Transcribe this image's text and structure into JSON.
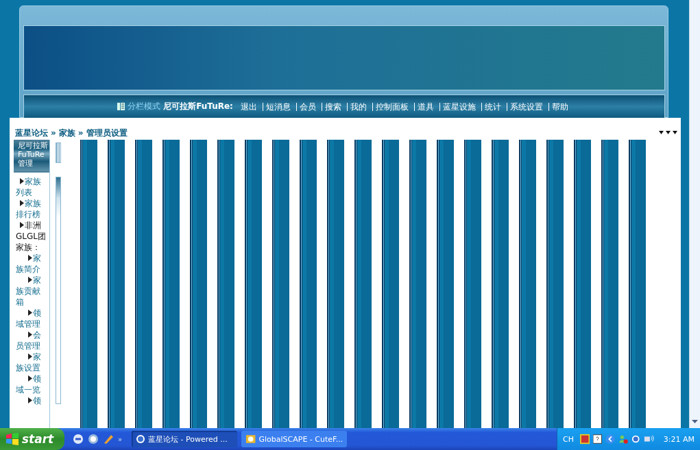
{
  "header": {
    "view_mode": "分栏模式",
    "user": "尼可拉斯FuTuRe:",
    "links": [
      "退出",
      "短消息",
      "会员",
      "搜索",
      "我的",
      "控制面板",
      "道具",
      "蓝星设施",
      "统计",
      "系统设置",
      "帮助"
    ]
  },
  "breadcrumb": {
    "separator": "»",
    "items": [
      "蓝星论坛",
      "家族",
      "管理员设置"
    ]
  },
  "sidebar": {
    "title": "尼可拉斯FuTuRe管理",
    "items": [
      {
        "label": "家族列表",
        "kind": "link"
      },
      {
        "label": "家族排行榜",
        "kind": "link"
      },
      {
        "label": "非洲GLGL团家族：",
        "kind": "group",
        "children": [
          {
            "label": "家族简介",
            "kind": "link"
          },
          {
            "label": "家族贡献箱",
            "kind": "link"
          },
          {
            "label": "领域管理",
            "kind": "link"
          },
          {
            "label": "会员管理",
            "kind": "link"
          },
          {
            "label": "家族设置",
            "kind": "link"
          },
          {
            "label": "领域一览",
            "kind": "link"
          },
          {
            "label": "领",
            "kind": "link"
          }
        ]
      }
    ]
  },
  "taskbar": {
    "start": "start",
    "more": "»",
    "tasks": [
      {
        "label": "蓝星论坛 - Powered ...",
        "selected": true
      },
      {
        "label": "GlobalSCAPE - CuteF...",
        "selected": false
      }
    ],
    "tray": {
      "language": "CH",
      "clock": "3:21 AM"
    }
  }
}
